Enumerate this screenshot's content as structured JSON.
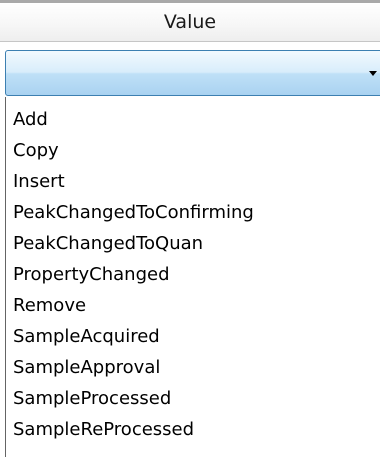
{
  "column_header": {
    "label": "Value"
  },
  "combo": {
    "selected_value": "",
    "arrow_icon": "chevron-down-icon"
  },
  "dropdown": {
    "options": [
      "Add",
      "Copy",
      "Insert",
      "PeakChangedToConfirming",
      "PeakChangedToQuan",
      "PropertyChanged",
      "Remove",
      "SampleAcquired",
      "SampleApproval",
      "SampleProcessed",
      "SampleReProcessed"
    ]
  },
  "colors": {
    "combo_border": "#3c7fb1",
    "combo_fill": "#bfe0f7"
  }
}
